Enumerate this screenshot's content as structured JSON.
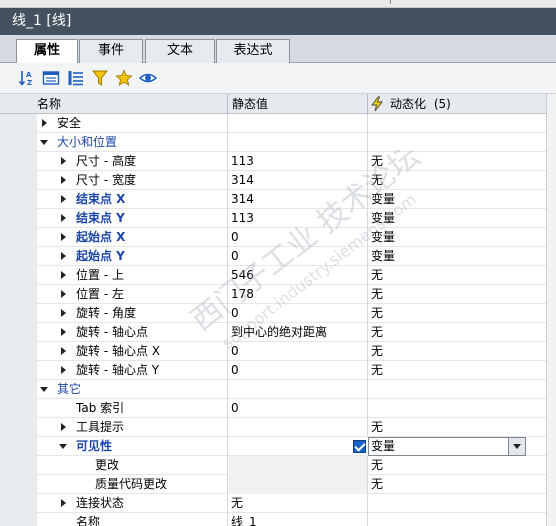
{
  "window": {
    "title": "线_1 [线]"
  },
  "tabs": [
    {
      "label": "属性",
      "active": true
    },
    {
      "label": "事件",
      "active": false
    },
    {
      "label": "文本",
      "active": false
    },
    {
      "label": "表达式",
      "active": false
    }
  ],
  "toolbar": {
    "icons": [
      "sort-az-icon",
      "group-view-icon",
      "list-view-icon",
      "filter-icon",
      "favorite-star-icon",
      "preview-eye-icon"
    ]
  },
  "columns": {
    "name": "名称",
    "static": "静态值",
    "dynamic": "动态化",
    "dynamic_count": "(5)"
  },
  "rows": [
    {
      "name": "安全",
      "value": "",
      "dyn": ""
    },
    {
      "name": "大小和位置",
      "value": "",
      "dyn": ""
    },
    {
      "name": "尺寸 - 高度",
      "value": "113",
      "dyn": "无"
    },
    {
      "name": "尺寸 - 宽度",
      "value": "314",
      "dyn": "无"
    },
    {
      "name": "结束点 X",
      "value": "314",
      "dyn": "变量"
    },
    {
      "name": "结束点 Y",
      "value": "113",
      "dyn": "变量"
    },
    {
      "name": "起始点 X",
      "value": "0",
      "dyn": "变量"
    },
    {
      "name": "起始点 Y",
      "value": "0",
      "dyn": "变量"
    },
    {
      "name": "位置 - 上",
      "value": "546",
      "dyn": "无"
    },
    {
      "name": "位置 - 左",
      "value": "178",
      "dyn": "无"
    },
    {
      "name": "旋转 - 角度",
      "value": "0",
      "dyn": "无"
    },
    {
      "name": "旋转 - 轴心点",
      "value": "到中心的绝对距离",
      "dyn": "无"
    },
    {
      "name": "旋转 - 轴心点 X",
      "value": "0",
      "dyn": "无"
    },
    {
      "name": "旋转 - 轴心点 Y",
      "value": "0",
      "dyn": "无"
    },
    {
      "name": "其它",
      "value": "",
      "dyn": ""
    },
    {
      "name": "Tab 索引",
      "value": "0",
      "dyn": ""
    },
    {
      "name": "工具提示",
      "value": "",
      "dyn": "无"
    },
    {
      "name": "可见性",
      "value": "",
      "dyn": "变量"
    },
    {
      "name": "更改",
      "value": "",
      "dyn": "无"
    },
    {
      "name": "质量代码更改",
      "value": "",
      "dyn": "无"
    },
    {
      "name": "连接状态",
      "value": "无",
      "dyn": ""
    },
    {
      "name": "名称",
      "value": "线_1",
      "dyn": ""
    }
  ],
  "watermark": {
    "line1": "西门子工业 技术论坛",
    "line2": "support.industry.siemens.com"
  }
}
